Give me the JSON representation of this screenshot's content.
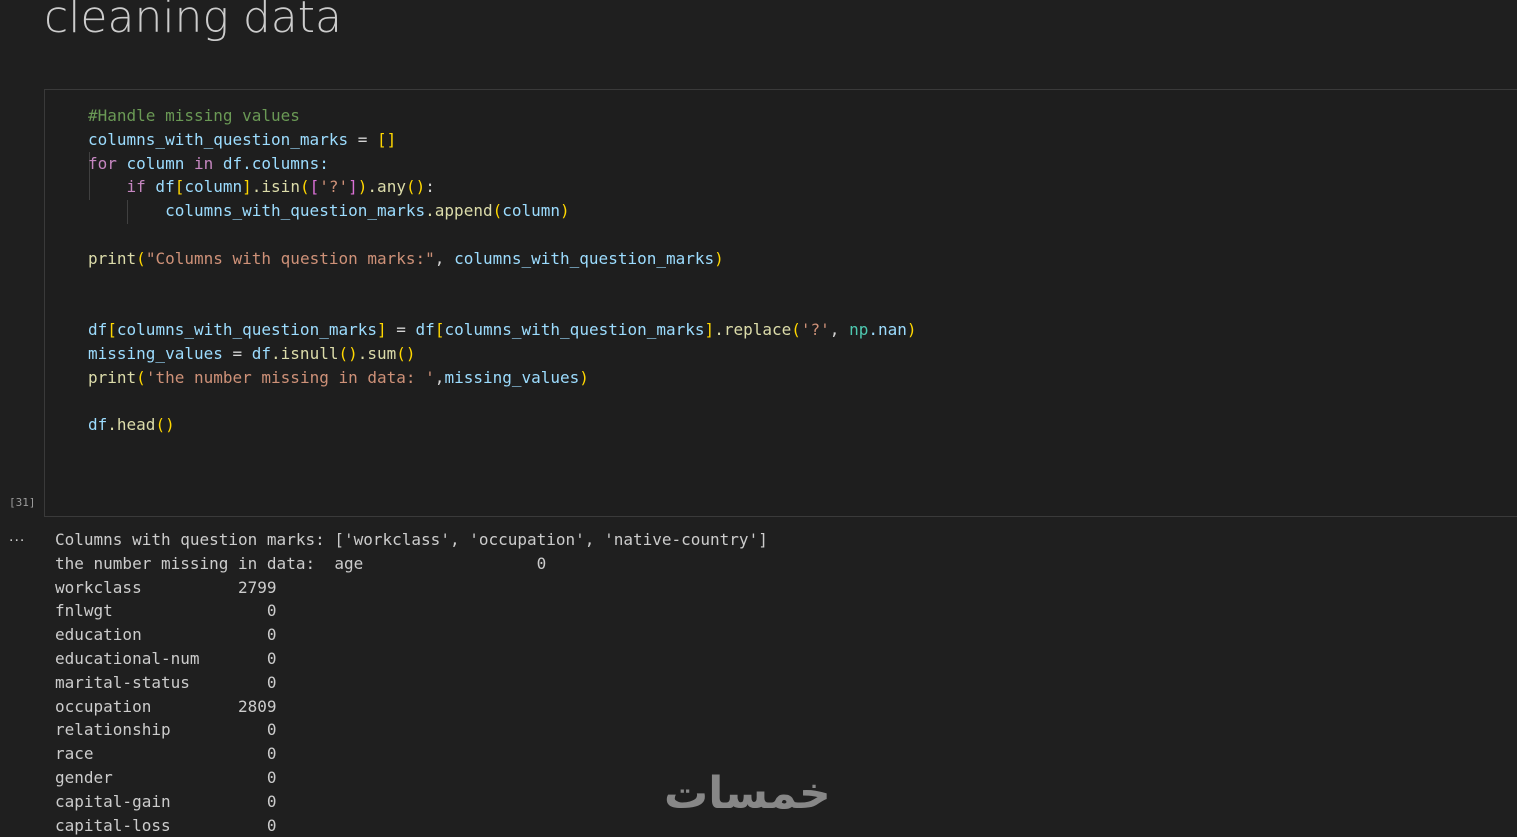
{
  "notebook": {
    "heading": "cleaning data",
    "cell": {
      "execution_count": "[31]",
      "code": {
        "l1_comment": "#Handle missing values",
        "l2_var": "columns_with_question_marks",
        "l2_rest": " = ",
        "l2_br": "[]",
        "l3_for": "for",
        "l3_a": " column ",
        "l3_in": "in",
        "l3_b": " df.columns:",
        "l4_if": "if",
        "l4_df": " df",
        "l4_br1": "[",
        "l4_col": "column",
        "l4_br2": "]",
        "l4_isin": ".isin",
        "l4_p1": "(",
        "l4_lb": "[",
        "l4_str": "'?'",
        "l4_rb": "]",
        "l4_p2": ")",
        "l4_any": ".any",
        "l4_p3": "()",
        "l4_colon": ":",
        "l5_var": "columns_with_question_marks",
        "l5_fn": ".append",
        "l5_p1": "(",
        "l5_arg": "column",
        "l5_p2": ")",
        "l7_fn": "print",
        "l7_p1": "(",
        "l7_str": "\"Columns with question marks:\"",
        "l7_sep": ", ",
        "l7_var": "columns_with_question_marks",
        "l7_p2": ")",
        "l10_df": "df",
        "l10_b1": "[",
        "l10_var": "columns_with_question_marks",
        "l10_b2": "]",
        "l10_eq": " = ",
        "l10_df2": "df",
        "l10_b3": "[",
        "l10_var2": "columns_with_question_marks",
        "l10_b4": "]",
        "l10_fn": ".replace",
        "l10_p1": "(",
        "l10_str": "'?'",
        "l10_sep": ", ",
        "l10_np": "np",
        "l10_nan": ".nan",
        "l10_p2": ")",
        "l11_var": "missing_values",
        "l11_eq": " = ",
        "l11_df": "df",
        "l11_fn": ".isnull",
        "l11_p1": "()",
        "l11_fn2": ".sum",
        "l11_p2": "()",
        "l12_fn": "print",
        "l12_p1": "(",
        "l12_str": "'the number missing in data: '",
        "l12_sep": ",",
        "l12_var": "missing_values",
        "l12_p2": ")",
        "l14_df": "df",
        "l14_fn": ".head",
        "l14_p": "()"
      }
    },
    "output": {
      "dots": "...",
      "line1": "Columns with question marks: ['workclass', 'occupation', 'native-country']",
      "line2": "the number missing in data:  age                  0",
      "rows": [
        "workclass          2799",
        "fnlwgt                0",
        "education             0",
        "educational-num       0",
        "marital-status        0",
        "occupation         2809",
        "relationship          0",
        "race                  0",
        "gender                0",
        "capital-gain          0",
        "capital-loss          0"
      ]
    },
    "watermark": "خمسات"
  }
}
